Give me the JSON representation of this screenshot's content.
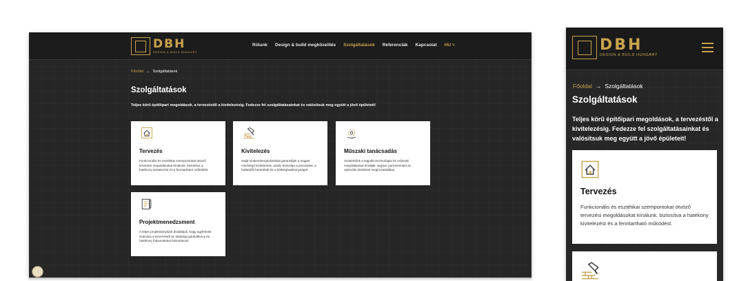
{
  "brand": {
    "name": "DBH",
    "tagline": "DESIGN & BUILD HUNGARY",
    "accent": "#c9a24d",
    "background": "#262626"
  },
  "nav": {
    "items": [
      {
        "label": "Rólunk",
        "active": false
      },
      {
        "label": "Design & build megközelítés",
        "active": false
      },
      {
        "label": "Szolgáltatások",
        "active": true
      },
      {
        "label": "Referenciák",
        "active": false
      },
      {
        "label": "Kapcsolat",
        "active": false
      }
    ],
    "lang": "HU"
  },
  "breadcrumb": {
    "home": "Főoldal",
    "separator": "→",
    "current": "Szolgáltatások"
  },
  "page": {
    "title": "Szolgáltatások",
    "intro": "Teljes körű építőipari megoldások, a tervezéstől a kivitelezésig. Fedezze fel szolgáltatásainkat és valósítsuk meg együtt a jövő épületeit!"
  },
  "services": [
    {
      "icon": "house-plan-icon",
      "title": "Tervezés",
      "text": "Funkcionális és esztétikai szempontokat ötvöző tervezési megoldásokat kínálunk, biztosítva a hatékony kivitelezést és a fenntartható működést."
    },
    {
      "icon": "brick-trowel-icon",
      "title": "Kivitelezés",
      "text": "Saját szakembergárdánkkal garantáljuk a magas minőségű kivitelezést, amely biztosítja a precizitást, a határidők betartását és a költséghatékonyságot."
    },
    {
      "icon": "gear-head-icon",
      "title": "Műszaki tanácsadás",
      "text": "Szakértőink a legjobb technológiai és műszaki megoldásokat kínálják, segítve partnereinket az optimális döntések meghozatalában."
    },
    {
      "icon": "clipboard-pen-icon",
      "title": "Projektmenedzsment",
      "text": "A teljes projektirányítást átvállaljuk, hogy ügyfeleink számára a tervezéstől az átadásig gördülékeny és hatékony folyamatokat biztosítsunk."
    }
  ],
  "cookie": {
    "icon": "cookie-icon"
  },
  "mobile": {
    "menu_icon": "hamburger-menu-icon"
  }
}
